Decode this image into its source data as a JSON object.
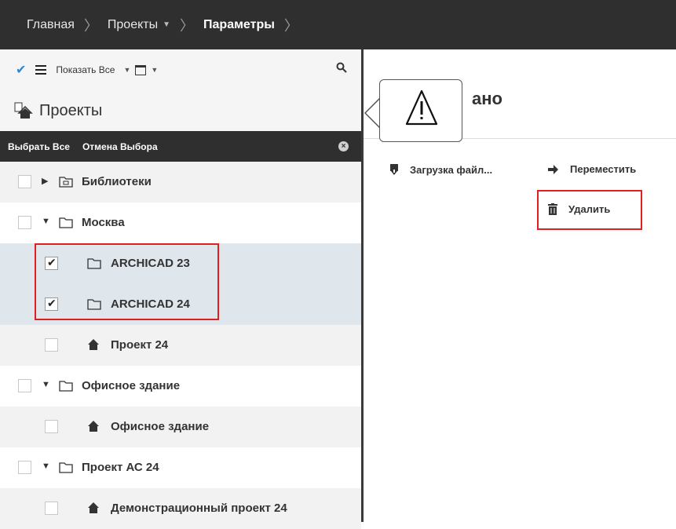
{
  "breadcrumb": {
    "home": "Главная",
    "projects": "Проекты",
    "current": "Параметры"
  },
  "toolbar": {
    "show_all": "Показать Все"
  },
  "panel": {
    "title": "Проекты",
    "select_all": "Выбрать Все",
    "cancel_selection": "Отмена Выбора"
  },
  "tree": [
    {
      "label": "Библиотеки",
      "type": "library",
      "expanded": false,
      "checked": false,
      "level": 0
    },
    {
      "label": "Москва",
      "type": "folder",
      "expanded": true,
      "checked": false,
      "level": 0
    },
    {
      "label": "ARCHICAD 23",
      "type": "folder",
      "checked": true,
      "level": 1
    },
    {
      "label": "ARCHICAD 24",
      "type": "folder",
      "checked": true,
      "level": 1
    },
    {
      "label": "Проект 24",
      "type": "project",
      "checked": false,
      "level": 1
    },
    {
      "label": "Офисное здание",
      "type": "folder",
      "expanded": true,
      "checked": false,
      "level": 0
    },
    {
      "label": "Офисное здание",
      "type": "project",
      "checked": false,
      "level": 1
    },
    {
      "label": "Проект АС 24",
      "type": "folder",
      "expanded": true,
      "checked": false,
      "level": 0
    },
    {
      "label": "Демонстрационный проект 24",
      "type": "project",
      "checked": false,
      "level": 1
    }
  ],
  "main": {
    "title_partial": "ано",
    "actions": {
      "upload": "Загрузка файл...",
      "move": "Переместить",
      "delete": "Удалить"
    }
  },
  "colors": {
    "topbar": "#2f2f2f",
    "highlight": "#e02020",
    "accent_check": "#2a86d6",
    "selected_row": "#dfe6ec"
  }
}
